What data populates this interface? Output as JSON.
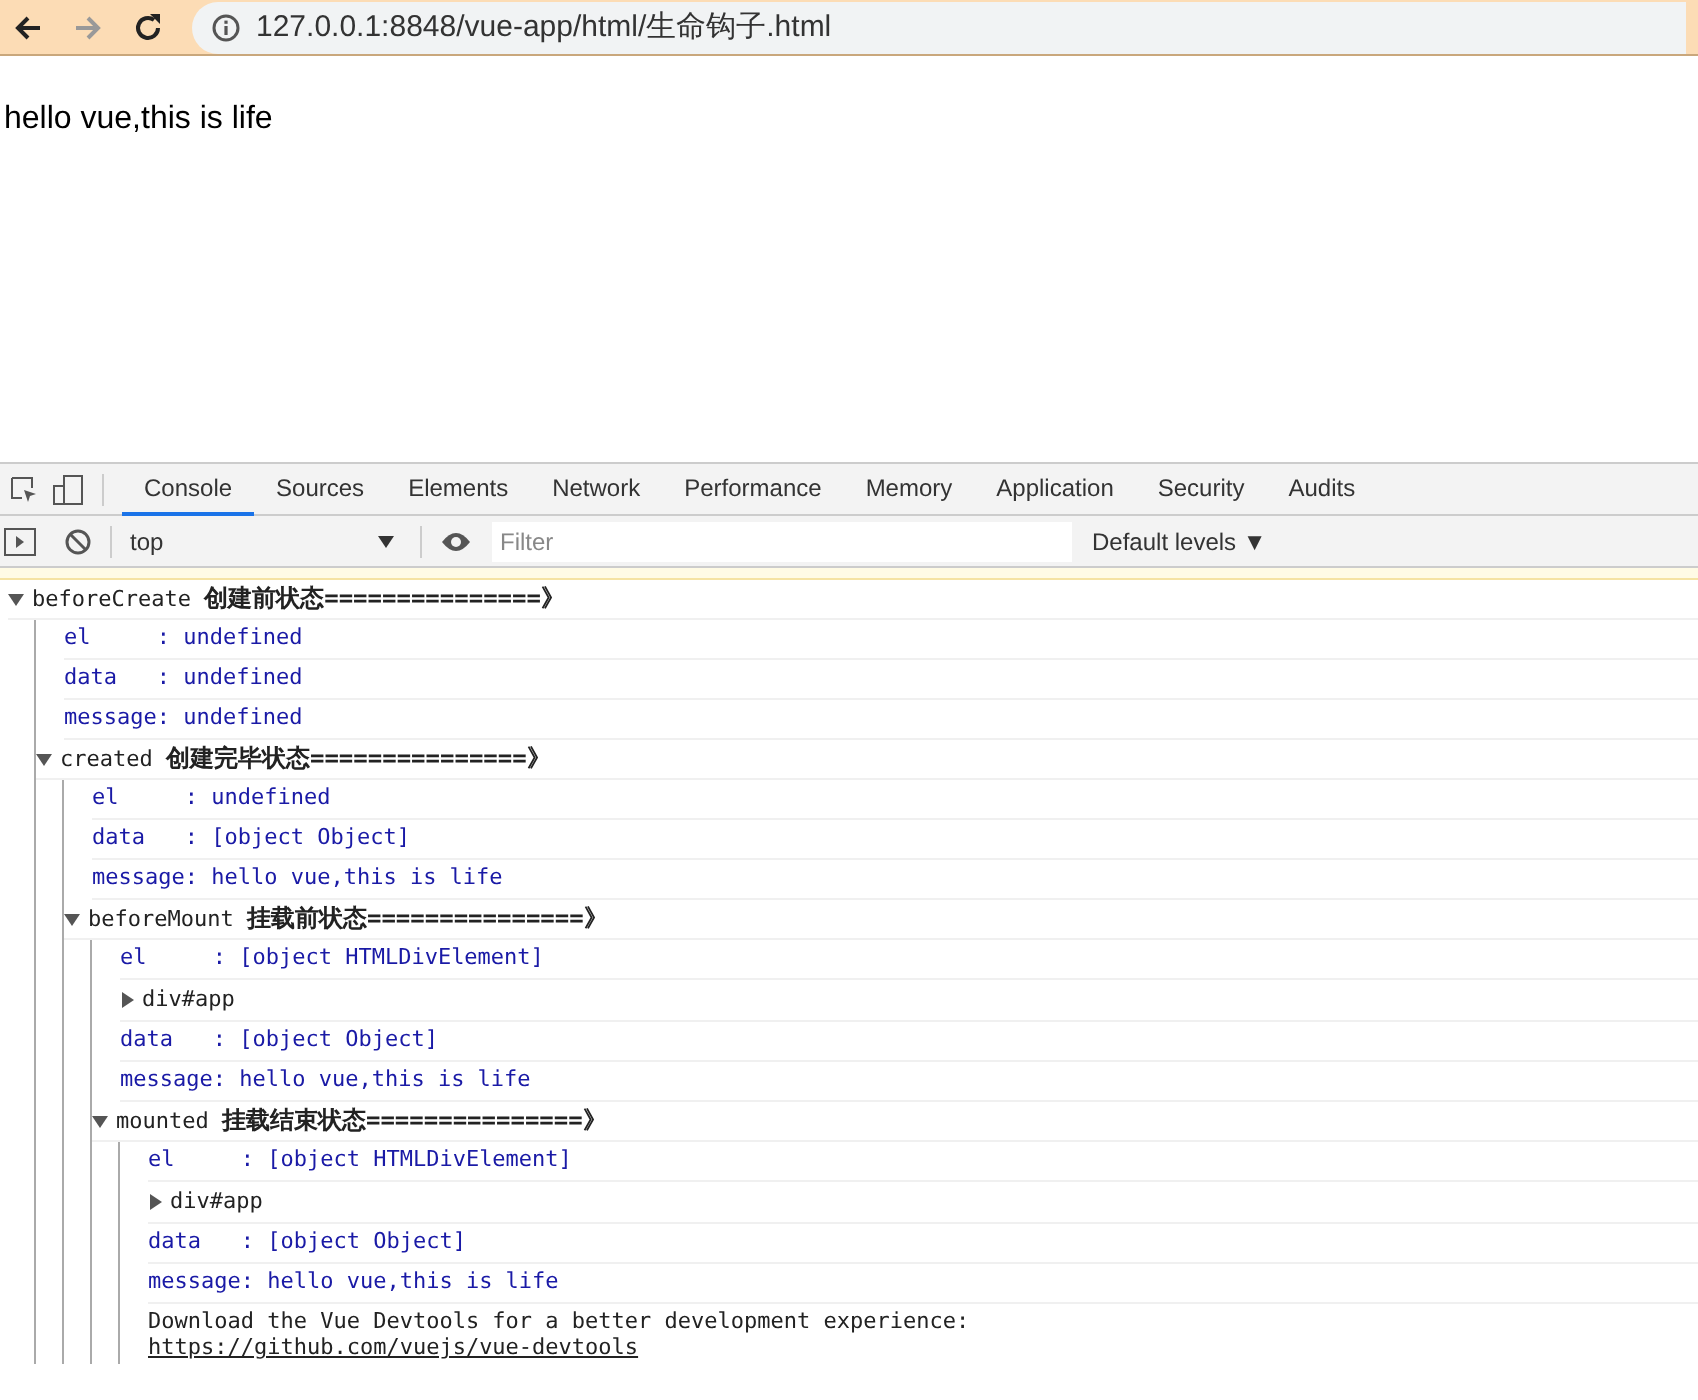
{
  "browser": {
    "url": "127.0.0.1:8848/vue-app/html/生命钩子.html"
  },
  "page": {
    "text": "hello vue,this is life"
  },
  "devtools": {
    "tabs": [
      {
        "label": "Console",
        "selected": true
      },
      {
        "label": "Sources",
        "selected": false
      },
      {
        "label": "Elements",
        "selected": false
      },
      {
        "label": "Network",
        "selected": false
      },
      {
        "label": "Performance",
        "selected": false
      },
      {
        "label": "Memory",
        "selected": false
      },
      {
        "label": "Application",
        "selected": false
      },
      {
        "label": "Security",
        "selected": false
      },
      {
        "label": "Audits",
        "selected": false
      }
    ],
    "context": "top",
    "filter": {
      "placeholder": "Filter"
    },
    "levels": "Default levels ▼"
  },
  "console": [
    {
      "kind": "group",
      "expanded": true,
      "name": "beforeCreate",
      "title": "创建前状态===============》",
      "children": [
        {
          "kind": "log",
          "text": "el     : undefined"
        },
        {
          "kind": "log",
          "text": "data   : undefined"
        },
        {
          "kind": "log",
          "text": "message: undefined"
        },
        {
          "kind": "group",
          "expanded": true,
          "name": "created",
          "title": "创建完毕状态===============》",
          "children": [
            {
              "kind": "log",
              "text": "el     : undefined"
            },
            {
              "kind": "log",
              "text": "data   : [object Object]"
            },
            {
              "kind": "log",
              "text": "message: hello vue,this is life"
            },
            {
              "kind": "group",
              "expanded": true,
              "name": "beforeMount",
              "title": "挂载前状态===============》",
              "children": [
                {
                  "kind": "log",
                  "text": "el     : [object HTMLDivElement]"
                },
                {
                  "kind": "node",
                  "expanded": false,
                  "text": "div#app"
                },
                {
                  "kind": "log",
                  "text": "data   : [object Object]"
                },
                {
                  "kind": "log",
                  "text": "message: hello vue,this is life"
                },
                {
                  "kind": "group",
                  "expanded": true,
                  "name": "mounted",
                  "title": "挂载结束状态===============》",
                  "children": [
                    {
                      "kind": "log",
                      "text": "el     : [object HTMLDivElement]"
                    },
                    {
                      "kind": "node",
                      "expanded": false,
                      "text": "div#app"
                    },
                    {
                      "kind": "log",
                      "text": "data   : [object Object]"
                    },
                    {
                      "kind": "log",
                      "text": "message: hello vue,this is life"
                    },
                    {
                      "kind": "info",
                      "text": "Download the Vue Devtools for a better development experience:",
                      "link": "https://github.com/vuejs/vue-devtools"
                    }
                  ]
                }
              ]
            }
          ]
        }
      ]
    }
  ]
}
